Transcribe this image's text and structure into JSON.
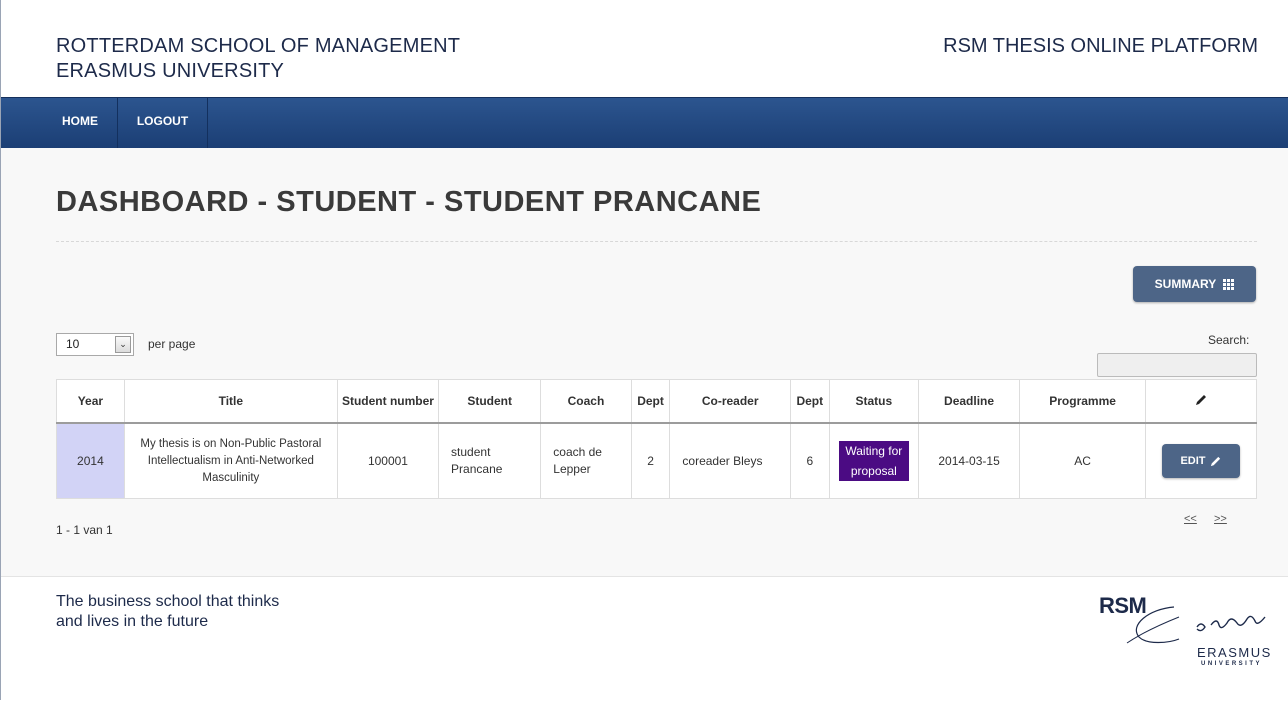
{
  "header": {
    "brand_line1": "ROTTERDAM SCHOOL OF MANAGEMENT",
    "brand_line2": "ERASMUS UNIVERSITY",
    "platform_title": "RSM THESIS ONLINE PLATFORM"
  },
  "nav": {
    "items": [
      {
        "label": "HOME",
        "active": true
      },
      {
        "label": "LOGOUT",
        "active": false
      }
    ]
  },
  "page": {
    "title": "DASHBOARD - STUDENT - STUDENT PRANCANE"
  },
  "toolbar": {
    "summary_label": "SUMMARY",
    "summary_icon": "grid-icon"
  },
  "table_controls": {
    "per_page_value": "10",
    "per_page_label": "per page",
    "search_label": "Search:",
    "search_value": ""
  },
  "table": {
    "columns": [
      "Year",
      "Title",
      "Student number",
      "Student",
      "Coach",
      "Dept",
      "Co-reader",
      "Dept",
      "Status",
      "Deadline",
      "Programme"
    ],
    "edit_column_icon": "pencil-icon",
    "rows": [
      {
        "year": "2014",
        "title": "My thesis is on Non-Public Pastoral Intellectualism in Anti-Networked Masculinity",
        "student_number": "100001",
        "student": "student Prancane",
        "coach": "coach de Lepper",
        "coach_dept": "2",
        "coreader": "coreader Bleys",
        "coreader_dept": "6",
        "status": "Waiting for proposal",
        "deadline": "2014-03-15",
        "programme": "AC",
        "edit_label": "EDIT"
      }
    ]
  },
  "pagination": {
    "info": "1 - 1 van 1",
    "prev": "<<",
    "next": ">>"
  },
  "footer": {
    "tagline_line1": "The business school that thinks",
    "tagline_line2": "and lives in the future",
    "logo_rsm": "RSM",
    "logo_signature": "Erasmus",
    "logo_erasmus": "ERASMUS",
    "logo_university": "UNIVERSITY"
  },
  "colors": {
    "nav_blue": "#1b3e74",
    "button_blue": "#4d6587",
    "status_purple": "#4b0b83",
    "year_highlight": "#d2d3f6",
    "brand_text": "#1d2a4a"
  }
}
